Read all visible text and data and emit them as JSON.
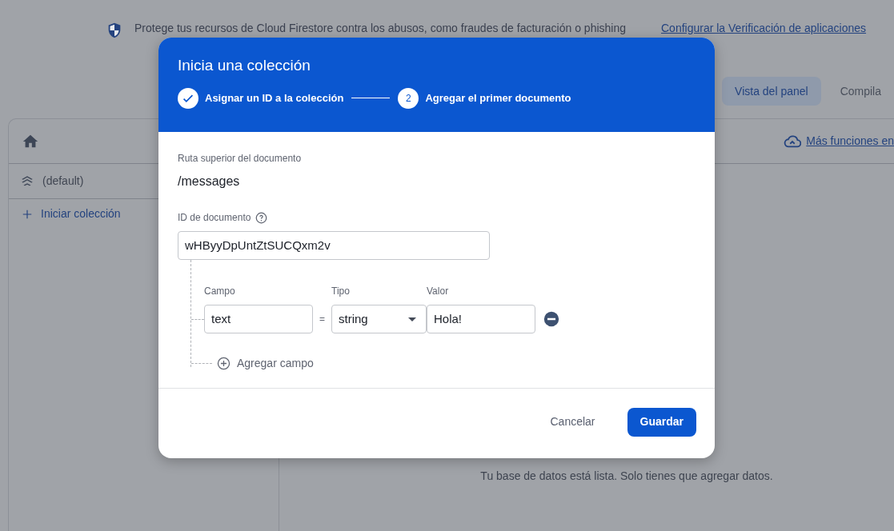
{
  "banner": {
    "text": "Protege tus recursos de Cloud Firestore contra los abusos, como fraudes de facturación o phishing",
    "link": "Configurar la Verificación de aplicaciones"
  },
  "view_tabs": [
    {
      "label": "Vista del panel",
      "selected": true
    },
    {
      "label": "Compila",
      "selected": false
    }
  ],
  "sidebar": {
    "database": "(default)",
    "add_collection": "Iniciar colección"
  },
  "toolbar": {
    "more": "Más funciones en"
  },
  "empty_message": "Tu base de datos está lista. Solo tienes que agregar datos.",
  "dialog": {
    "title": "Inicia una colección",
    "steps": [
      {
        "label": "Asignar un ID a la colección",
        "completed": true
      },
      {
        "label": "Agregar el primer documento",
        "number": "2",
        "completed": false
      }
    ],
    "parent_path": {
      "label": "Ruta superior del documento",
      "value": "/messages"
    },
    "document_id": {
      "label": "ID de documento",
      "value": "wHByyDpUntZtSUCQxm2v"
    },
    "field_headers": [
      "Campo",
      "Tipo",
      "Valor"
    ],
    "fields": [
      {
        "name": "text",
        "equals": "=",
        "type": "string",
        "value": "Hola!"
      }
    ],
    "add_field": "Agregar campo",
    "buttons": [
      {
        "label": "Cancelar",
        "kind": "text"
      },
      {
        "label": "Guardar",
        "kind": "primary"
      }
    ]
  }
}
